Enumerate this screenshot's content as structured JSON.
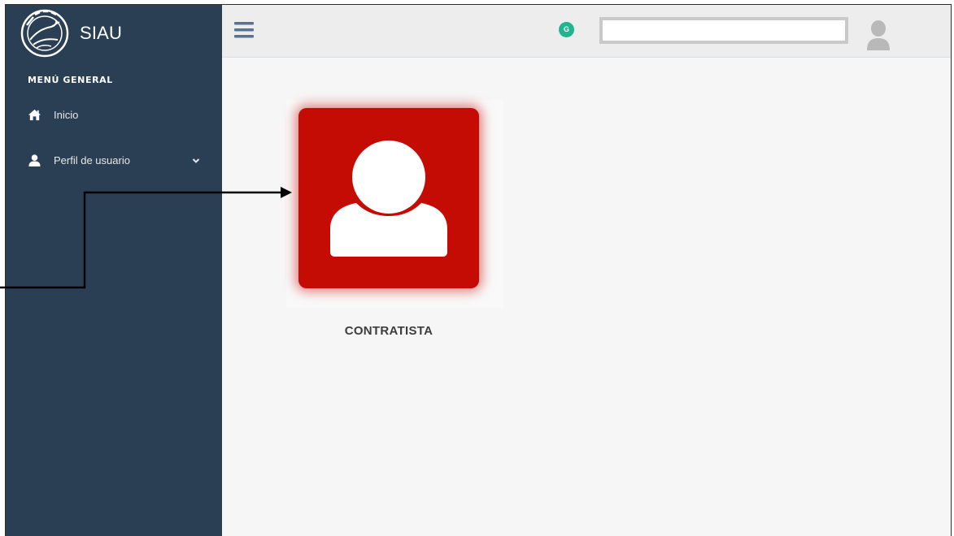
{
  "brand": {
    "title": "SIAU",
    "logo_icon": "unillanos-heron-logo-icon"
  },
  "sidebar": {
    "section_title": "MENÚ GENERAL",
    "items": [
      {
        "label": "Inicio",
        "icon": "home-icon"
      },
      {
        "label": "Perfil de usuario",
        "icon": "user-icon",
        "has_submenu": true
      }
    ]
  },
  "topbar": {
    "menu_icon": "hamburger-icon",
    "badge_text": "G",
    "search_value": "",
    "avatar_icon": "user-avatar-icon"
  },
  "main": {
    "tile": {
      "label": "CONTRATISTA",
      "icon": "user-silhouette-icon",
      "color": "#c40c04"
    }
  },
  "colors": {
    "sidebar_bg": "#2a3f54",
    "content_bg": "#f6f6f6",
    "badge": "#1fb58f",
    "accent": "#c40c04"
  }
}
